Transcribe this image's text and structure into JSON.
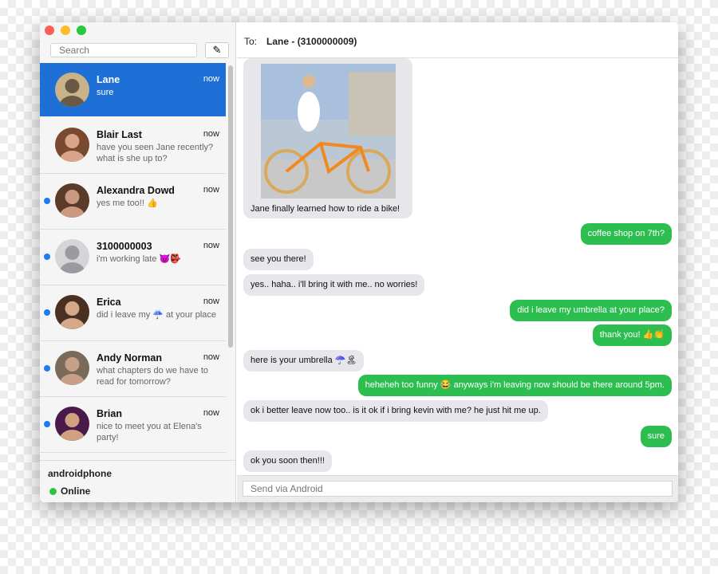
{
  "window": {
    "controls": {
      "close": "#fc5f57",
      "minimize": "#fdbc2e",
      "zoom": "#28c840"
    }
  },
  "sidebar": {
    "search_placeholder": "Search",
    "compose_icon": "compose-icon",
    "conversations": [
      {
        "name": "Lane",
        "time": "now",
        "preview": "sure",
        "selected": true,
        "unread": false
      },
      {
        "name": "Blair Last",
        "time": "now",
        "preview": "have you seen Jane recently? what is she up to?",
        "unread": false
      },
      {
        "name": "Alexandra Dowd",
        "time": "now",
        "preview": "yes me too!! 👍",
        "unread": true
      },
      {
        "name": "3100000003",
        "time": "now",
        "preview": "i'm working late 👿👺",
        "unread": true
      },
      {
        "name": "Erica",
        "time": "now",
        "preview": "did i leave my ☔ at your place",
        "unread": true
      },
      {
        "name": "Andy Norman",
        "time": "now",
        "preview": "what chapters do we have to read for tomorrow?",
        "unread": true
      },
      {
        "name": "Brian",
        "time": "now",
        "preview": "nice to meet you at Elena's party!",
        "unread": true
      }
    ],
    "footer": {
      "device": "androidphone",
      "status": "Online",
      "status_color": "#28c840"
    }
  },
  "header": {
    "to_label": "To:",
    "recipient": "Lane - (3100000009)"
  },
  "messages": [
    {
      "side": "left",
      "type": "image",
      "text": "Jane finally learned how to ride a bike!"
    },
    {
      "side": "right",
      "text": "coffee shop on 7th?"
    },
    {
      "side": "left",
      "text": "see you there!"
    },
    {
      "side": "left",
      "text": "yes.. haha.. i'll bring it with me.. no worries!"
    },
    {
      "side": "right",
      "text": "did i leave my umbrella at your place?"
    },
    {
      "side": "right",
      "text": "thank you! 👍👏"
    },
    {
      "side": "left",
      "text": "here is your umbrella ☂️🏝"
    },
    {
      "side": "right",
      "text": "heheheh too funny 😂 anyways i'm leaving now should be there around 5pm."
    },
    {
      "side": "left",
      "text": "ok i better leave now too.. is it ok if i bring kevin with me? he just hit me up."
    },
    {
      "side": "right",
      "text": "sure"
    },
    {
      "side": "left",
      "text": "ok you soon then!!!"
    }
  ],
  "composer": {
    "placeholder": "Send via Android"
  },
  "colors": {
    "selected": "#1f70d6",
    "outgoing": "#2cbf4f",
    "incoming": "#e6e6eb",
    "unread_dot": "#1e7af0"
  }
}
